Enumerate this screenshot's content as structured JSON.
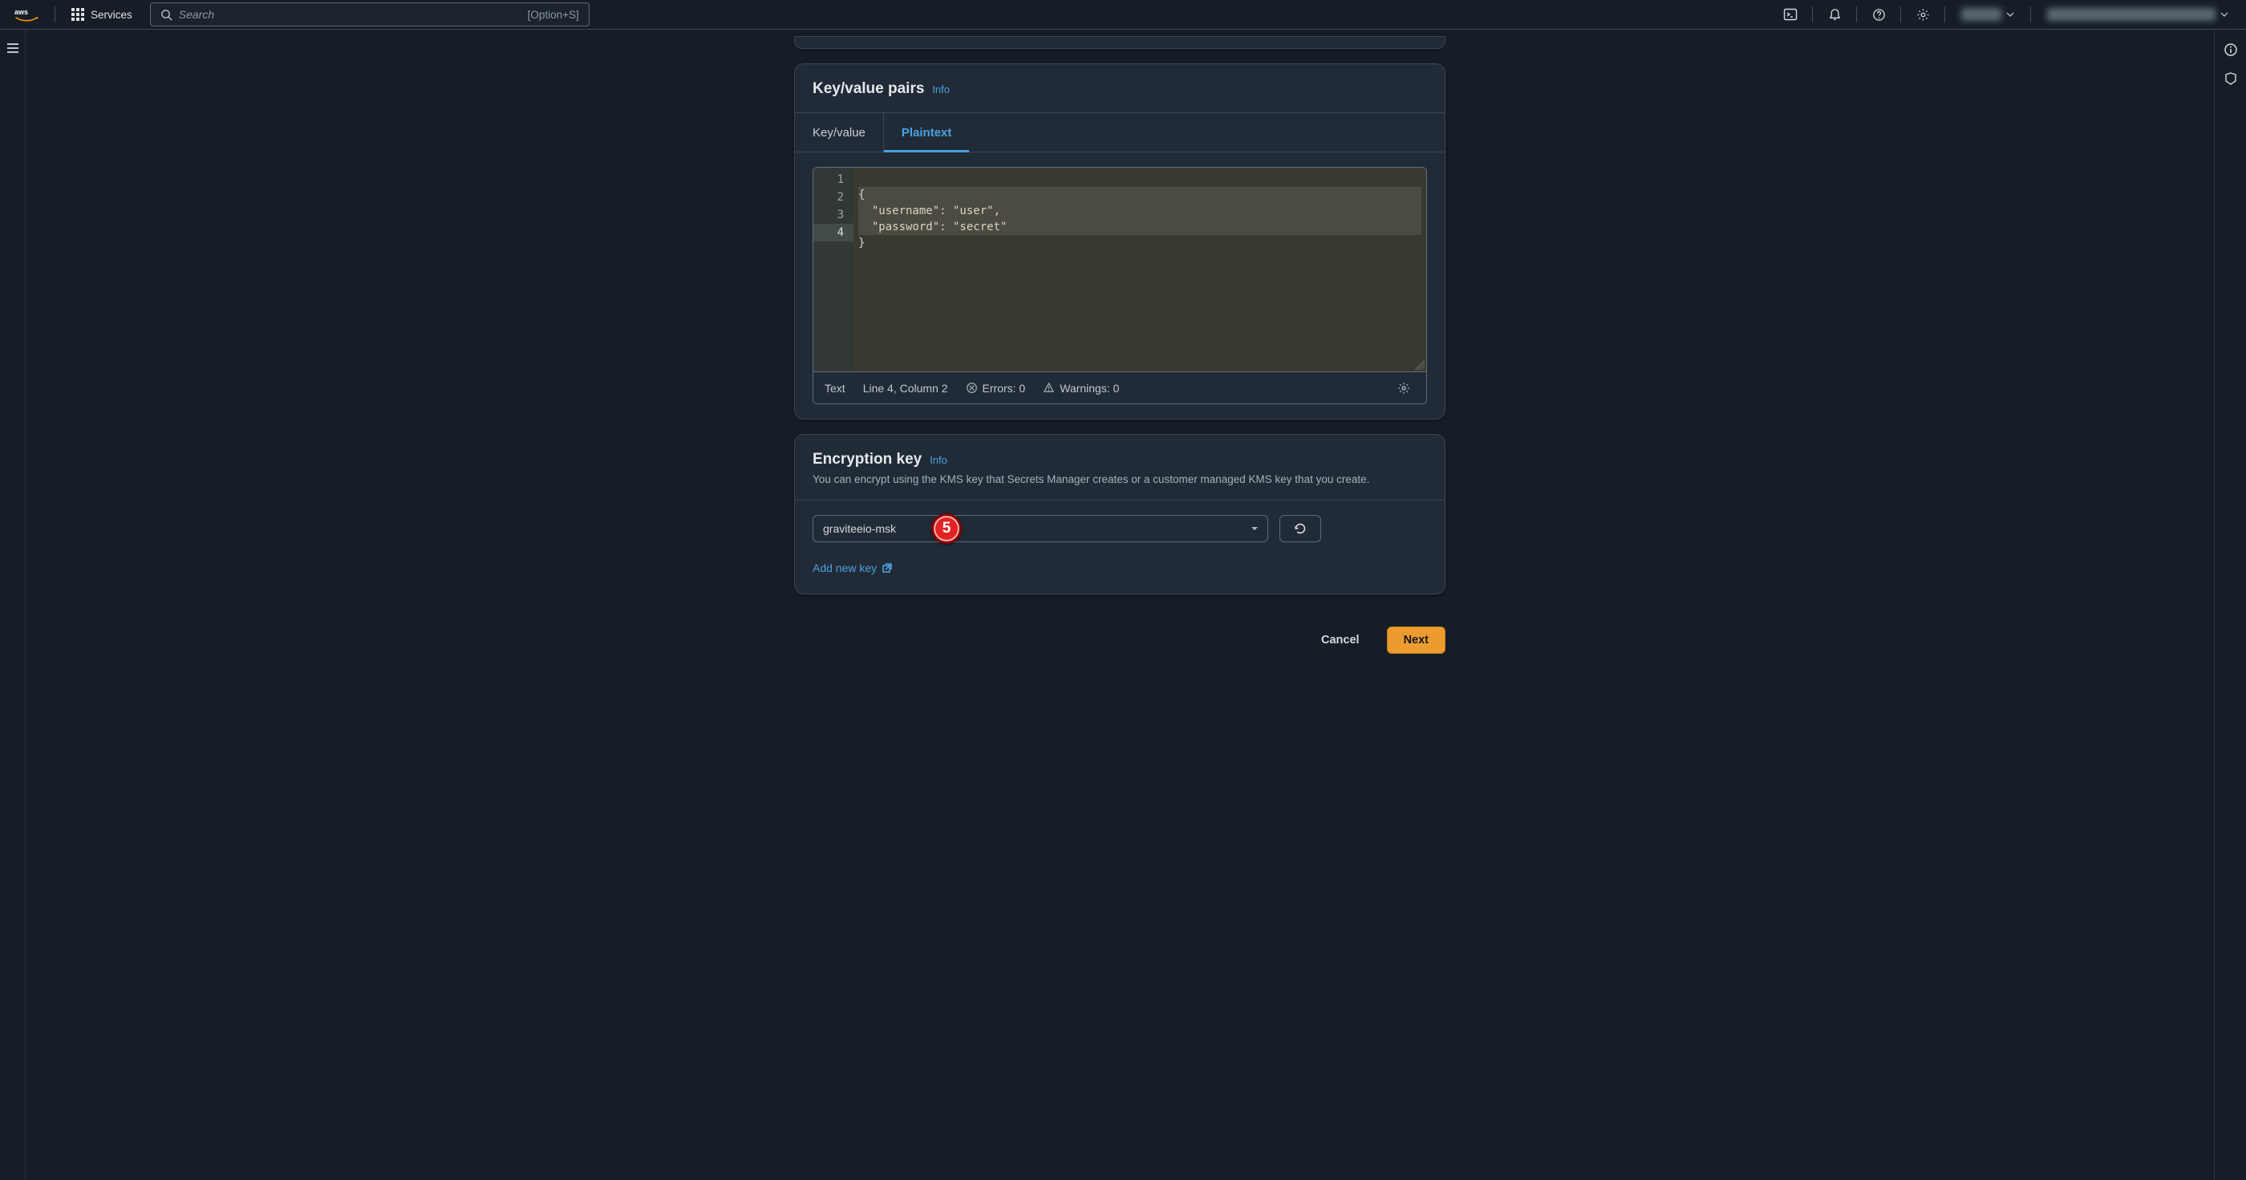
{
  "topnav": {
    "services_label": "Services",
    "search_placeholder": "Search",
    "search_shortcut": "[Option+S]"
  },
  "keyvalue_card": {
    "title": "Key/value pairs",
    "info_label": "Info",
    "tabs": {
      "keyvalue": "Key/value",
      "plaintext": "Plaintext"
    },
    "code_lines": [
      "{",
      "  \"username\": \"user\",",
      "  \"password\": \"secret\"",
      "}"
    ],
    "gutter_lines": [
      "1",
      "2",
      "3",
      "4"
    ],
    "status": {
      "mode": "Text",
      "position": "Line 4, Column 2",
      "errors_label": "Errors: 0",
      "warnings_label": "Warnings: 0"
    }
  },
  "encryption_card": {
    "title": "Encryption key",
    "info_label": "Info",
    "description": "You can encrypt using the KMS key that Secrets Manager creates or a customer managed KMS key that you create.",
    "selected_key": "graviteeio-msk",
    "add_new_key_label": "Add new key"
  },
  "annotation": {
    "marker": "5"
  },
  "wizard": {
    "cancel": "Cancel",
    "next": "Next"
  }
}
